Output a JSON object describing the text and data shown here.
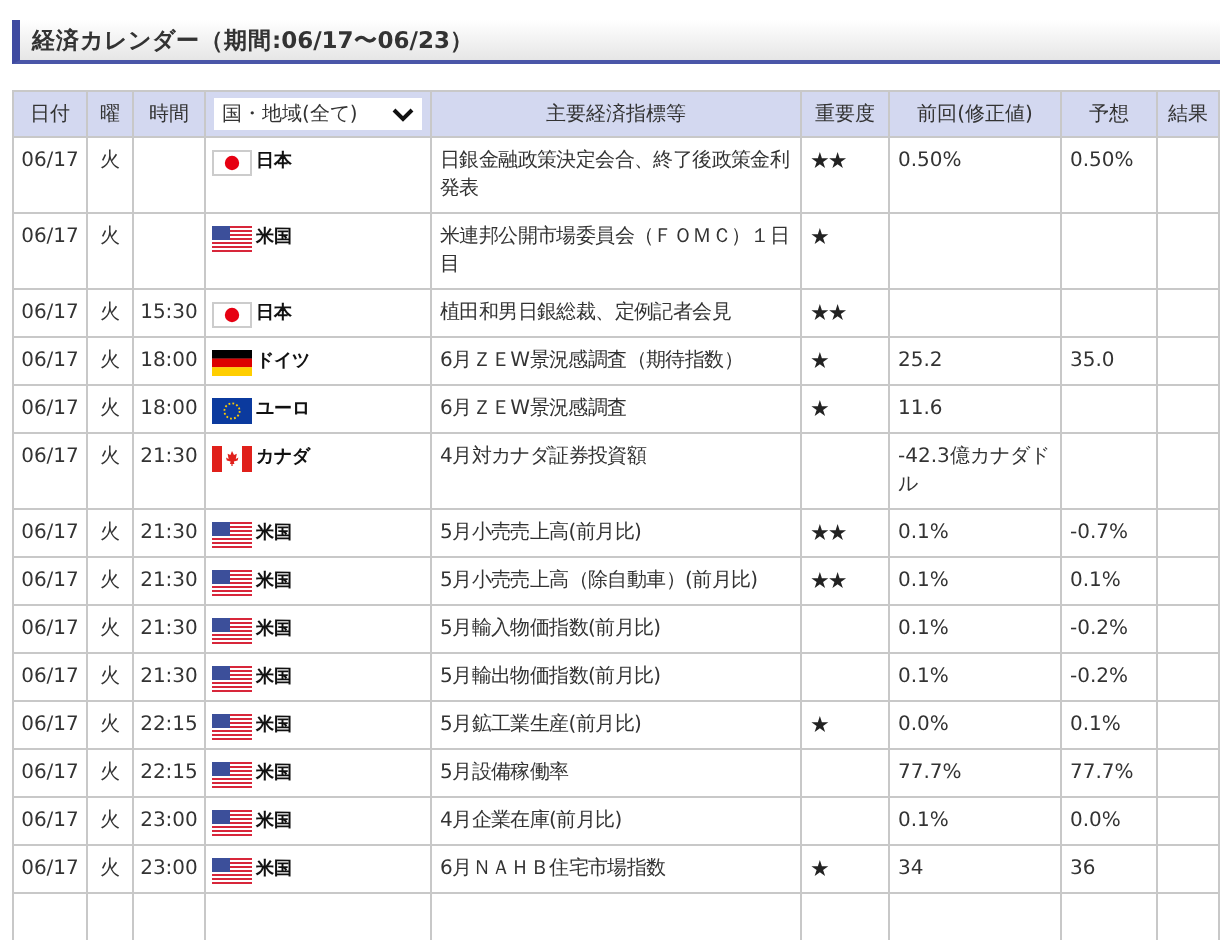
{
  "title": "経済カレンダー（期間:06/17〜06/23）",
  "columns": {
    "date": "日付",
    "weekday": "曜",
    "time": "時間",
    "region_filter": "国・地域(全て)",
    "indicator": "主要経済指標等",
    "importance": "重要度",
    "previous": "前回(修正値)",
    "forecast": "予想",
    "result": "結果"
  },
  "rows": [
    {
      "date": "06/17",
      "weekday": "火",
      "country": {
        "kind": "jp",
        "name": "日本"
      },
      "indicator": "日銀金融政策決定会合、終了後政策金利発表",
      "importance": "★★",
      "previous": "0.50%",
      "forecast": "0.50%"
    },
    {
      "date": "06/17",
      "weekday": "火",
      "country": {
        "kind": "us",
        "name": "米国"
      },
      "indicator": "米連邦公開市場委員会（ＦＯＭＣ）１日目",
      "importance": "★"
    },
    {
      "date": "06/17",
      "weekday": "火",
      "time": "15:30",
      "country": {
        "kind": "jp",
        "name": "日本"
      },
      "indicator": "植田和男日銀総裁、定例記者会見",
      "importance": "★★"
    },
    {
      "date": "06/17",
      "weekday": "火",
      "time": "18:00",
      "country": {
        "kind": "de",
        "name": "ドイツ"
      },
      "indicator": "6月ＺＥW景況感調査（期待指数）",
      "importance": "★",
      "previous": "25.2",
      "forecast": "35.0"
    },
    {
      "date": "06/17",
      "weekday": "火",
      "time": "18:00",
      "country": {
        "kind": "eu",
        "name": "ユーロ"
      },
      "indicator": "6月ＺＥW景況感調査",
      "importance": "★",
      "previous": "11.6"
    },
    {
      "date": "06/17",
      "weekday": "火",
      "time": "21:30",
      "country": {
        "kind": "ca",
        "name": "カナダ"
      },
      "indicator": "4月対カナダ証券投資額",
      "previous": "-42.3億カナダドル"
    },
    {
      "date": "06/17",
      "weekday": "火",
      "time": "21:30",
      "country": {
        "kind": "us",
        "name": "米国"
      },
      "indicator": "5月小売売上高(前月比)",
      "importance": "★★",
      "previous": "0.1%",
      "forecast": "-0.7%"
    },
    {
      "date": "06/17",
      "weekday": "火",
      "time": "21:30",
      "country": {
        "kind": "us",
        "name": "米国"
      },
      "indicator": "5月小売売上高（除自動車）(前月比)",
      "importance": "★★",
      "previous": "0.1%",
      "forecast": "0.1%"
    },
    {
      "date": "06/17",
      "weekday": "火",
      "time": "21:30",
      "country": {
        "kind": "us",
        "name": "米国"
      },
      "indicator": "5月輸入物価指数(前月比)",
      "previous": "0.1%",
      "forecast": "-0.2%"
    },
    {
      "date": "06/17",
      "weekday": "火",
      "time": "21:30",
      "country": {
        "kind": "us",
        "name": "米国"
      },
      "indicator": "5月輸出物価指数(前月比)",
      "previous": "0.1%",
      "forecast": "-0.2%"
    },
    {
      "date": "06/17",
      "weekday": "火",
      "time": "22:15",
      "country": {
        "kind": "us",
        "name": "米国"
      },
      "indicator": "5月鉱工業生産(前月比)",
      "importance": "★",
      "previous": "0.0%",
      "forecast": "0.1%"
    },
    {
      "date": "06/17",
      "weekday": "火",
      "time": "22:15",
      "country": {
        "kind": "us",
        "name": "米国"
      },
      "indicator": "5月設備稼働率",
      "previous": "77.7%",
      "forecast": "77.7%"
    },
    {
      "date": "06/17",
      "weekday": "火",
      "time": "23:00",
      "country": {
        "kind": "us",
        "name": "米国"
      },
      "indicator": "4月企業在庫(前月比)",
      "previous": "0.1%",
      "forecast": "0.0%"
    },
    {
      "date": "06/17",
      "weekday": "火",
      "time": "23:00",
      "country": {
        "kind": "us",
        "name": "米国"
      },
      "indicator": "6月ＮＡＨＢ住宅市場指数",
      "importance": "★",
      "previous": "34",
      "forecast": "36"
    }
  ]
}
